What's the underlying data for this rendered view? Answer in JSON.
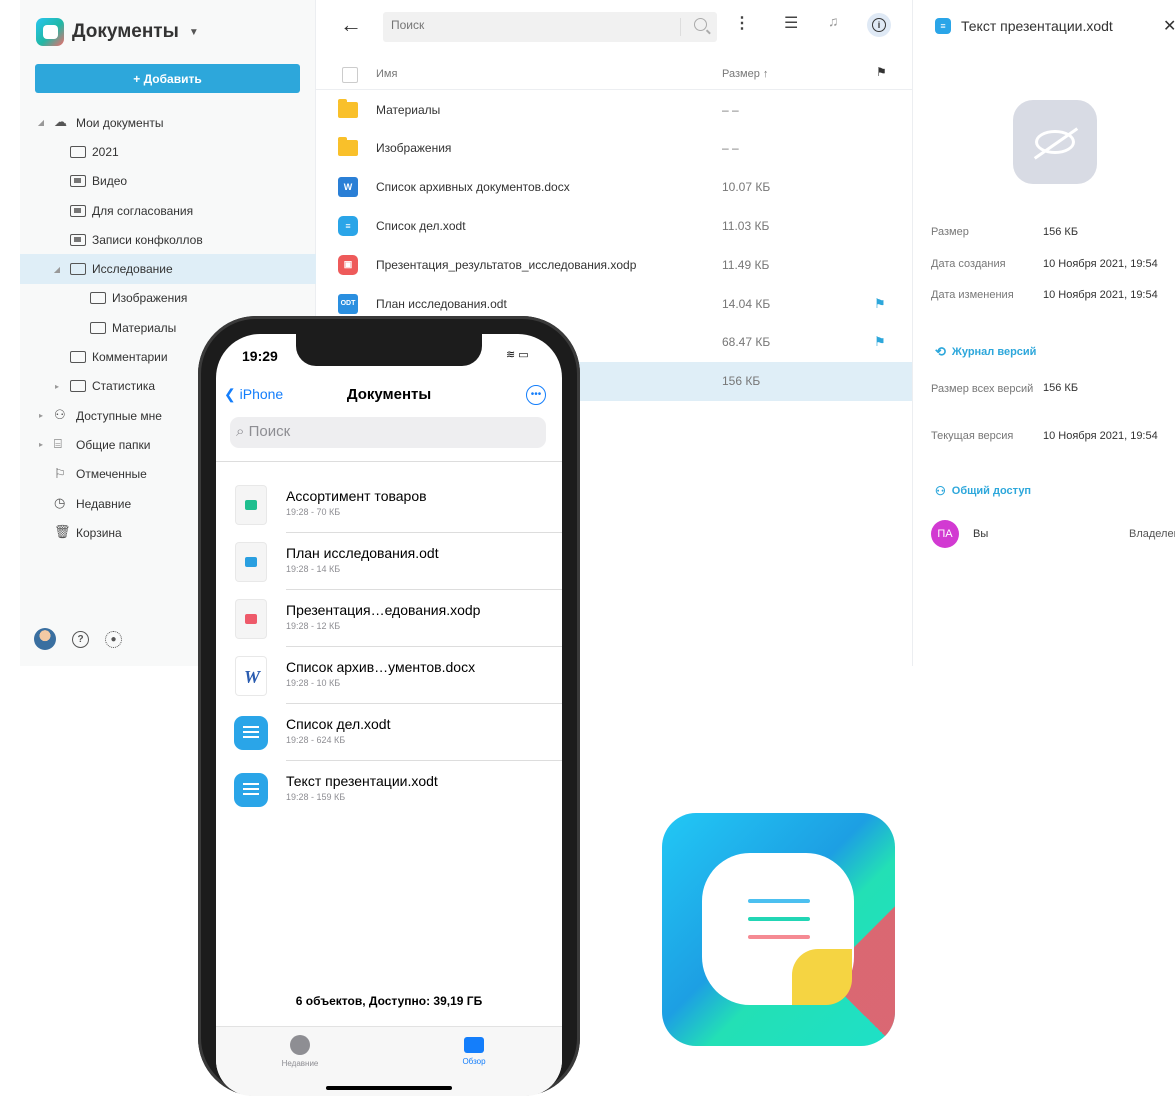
{
  "colors": {
    "accent": "#2da7db",
    "ios_blue": "#147efb",
    "selected_row": "#dfeef7"
  },
  "app": {
    "title": "Документы",
    "add_button": "+ Добавить"
  },
  "tree": [
    {
      "label": "Мои документы",
      "level": 0,
      "icon": "cloud-icon",
      "expander": "◢"
    },
    {
      "label": "2021",
      "level": 1,
      "icon": "folder-icon"
    },
    {
      "label": "Видео",
      "level": 1,
      "icon": "media-folder-icon"
    },
    {
      "label": "Для согласования",
      "level": 1,
      "icon": "media-folder-icon"
    },
    {
      "label": "Записи конфколлов",
      "level": 1,
      "icon": "media-folder-icon"
    },
    {
      "label": "Исследование",
      "level": 1,
      "icon": "folder-icon",
      "expander": "◢",
      "selected": true
    },
    {
      "label": "Изображения",
      "level": 2,
      "icon": "folder-icon"
    },
    {
      "label": "Материалы",
      "level": 2,
      "icon": "folder-icon"
    },
    {
      "label": "Комментарии",
      "level": 1,
      "icon": "folder-icon"
    },
    {
      "label": "Статистика",
      "level": 1,
      "icon": "folder-icon",
      "expander": "▸"
    },
    {
      "label": "Доступные мне",
      "level": 0,
      "icon": "people-icon",
      "expander": "▸"
    },
    {
      "label": "Общие папки",
      "level": 0,
      "icon": "briefcase-icon",
      "expander": "▸"
    },
    {
      "label": "Отмеченные",
      "level": 0,
      "icon": "flag-icon"
    },
    {
      "label": "Недавние",
      "level": 0,
      "icon": "clock-icon"
    },
    {
      "label": "Корзина",
      "level": 0,
      "icon": "trash-icon"
    }
  ],
  "toolbar": {
    "search_placeholder": "Поиск"
  },
  "table": {
    "col_name": "Имя",
    "col_size": "Размер ↑"
  },
  "files": [
    {
      "name": "Материалы",
      "size": "– –",
      "type": "folder",
      "flag": false
    },
    {
      "name": "Изображения",
      "size": "– –",
      "type": "folder",
      "flag": false
    },
    {
      "name": "Список архивных документов.docx",
      "size": "10.07 КБ",
      "type": "docx",
      "flag": false
    },
    {
      "name": "Список дел.xodt",
      "size": "11.03 КБ",
      "type": "xodt",
      "flag": false
    },
    {
      "name": "Презентация_результатов_исследования.xodp",
      "size": "11.49 КБ",
      "type": "xodp",
      "flag": false
    },
    {
      "name": "План исследования.odt",
      "size": "14.04 КБ",
      "type": "odt",
      "flag": true
    },
    {
      "name": "",
      "size": "68.47 КБ",
      "type": "hidden",
      "flag": true
    },
    {
      "name": "",
      "size": "156 КБ",
      "type": "hidden",
      "flag": false,
      "selected": true
    }
  ],
  "panel": {
    "title": "Текст презентации.xodt",
    "size_label": "Размер",
    "size_value": "156 КБ",
    "created_label": "Дата создания",
    "created_value": "10 Ноября 2021, 19:54",
    "modified_label": "Дата изменения",
    "modified_value": "10 Ноября 2021, 19:54",
    "versions_link": "Журнал версий",
    "all_versions_label": "Размер всех версий",
    "all_versions_value": "156 КБ",
    "current_version_label": "Текущая версия",
    "current_version_value": "10 Ноября 2021, 19:54",
    "sharing_link": "Общий доступ",
    "share_avatar": "ПА",
    "share_name": "Вы",
    "share_role": "Владелец"
  },
  "phone": {
    "time": "19:29",
    "back_label": "iPhone",
    "title": "Документы",
    "search_placeholder": "Поиск",
    "items": [
      {
        "name": "Ассортимент товаров",
        "meta": "19:28 - 70 КБ",
        "icon": "spreadsheet-icon"
      },
      {
        "name": "План исследования.odt",
        "meta": "19:28 - 14 КБ",
        "icon": "odt-icon"
      },
      {
        "name": "Презентация…едования.xodp",
        "meta": "19:28 - 12 КБ",
        "icon": "presentation-icon"
      },
      {
        "name": "Список архив…ументов.docx",
        "meta": "19:28 - 10 КБ",
        "icon": "word-icon"
      },
      {
        "name": "Список дел.xodt",
        "meta": "19:28 - 624 КБ",
        "icon": "xodt-icon"
      },
      {
        "name": "Текст презентации.xodt",
        "meta": "19:28 - 159 КБ",
        "icon": "xodt-icon"
      }
    ],
    "footer_count": "6 объектов, Доступно: 39,19 ГБ",
    "tab_recent": "Недавние",
    "tab_browse": "Обзор"
  }
}
